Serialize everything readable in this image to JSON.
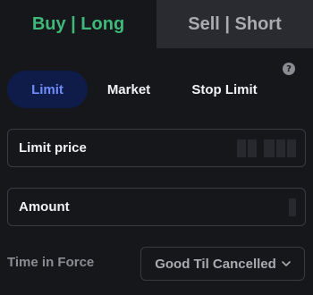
{
  "side_tabs": {
    "buy_label": "Buy | Long",
    "sell_label": "Sell | Short",
    "active": "buy"
  },
  "order_types": [
    {
      "label": "Limit",
      "active": true
    },
    {
      "label": "Market",
      "active": false
    },
    {
      "label": "Stop Limit",
      "active": false
    }
  ],
  "help": {
    "icon": "question-icon",
    "glyph": "?"
  },
  "fields": {
    "limit_price": {
      "label": "Limit price"
    },
    "amount": {
      "label": "Amount"
    }
  },
  "time_in_force": {
    "label": "Time in Force",
    "selected": "Good Til Cancelled",
    "icon": "chevron-down-icon"
  },
  "colors": {
    "background": "#16171b",
    "buy_green": "#3fb879",
    "sell_tab_bg": "#2a2b30",
    "limit_pill_bg": "#0f1c4a",
    "limit_pill_text": "#6f8df8",
    "border": "#3a3b41",
    "muted_text": "#8b8c92"
  }
}
